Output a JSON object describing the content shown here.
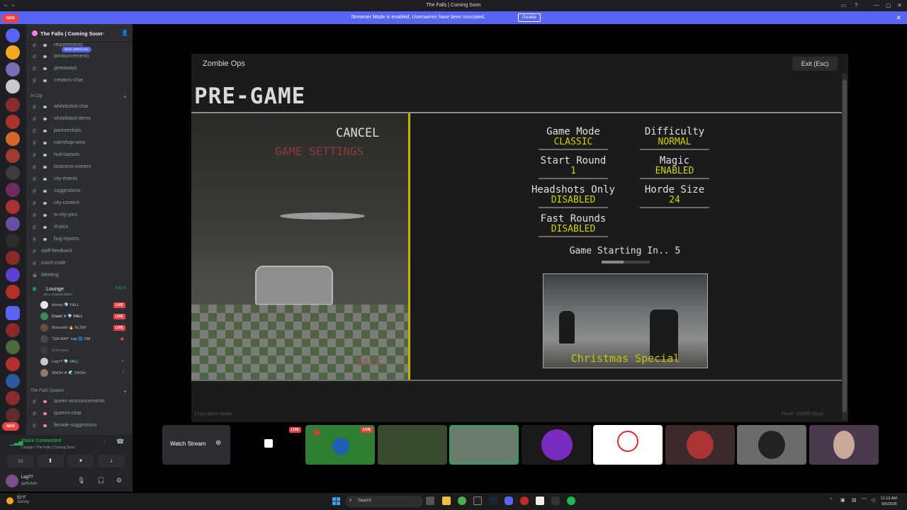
{
  "window": {
    "title": "The Falls | Coming Soon",
    "controls": [
      "▭",
      "?",
      "—",
      "▢",
      "✕"
    ]
  },
  "banner": {
    "message": "Streamer Mode is enabled. Usernames have been truncated.",
    "disable_label": "Disable"
  },
  "rail": {
    "new_badge": "NEW",
    "bottom_badge": "NEW"
  },
  "server": {
    "name": "The Falls | Coming Soon",
    "new_unreads": "NEW UNREADS"
  },
  "channels": {
    "top": [
      {
        "label": "requirements"
      },
      {
        "label": "announcements"
      },
      {
        "label": "giveaways"
      },
      {
        "label": "creators-chat"
      }
    ],
    "in_city_category": "In City",
    "in_city": [
      {
        "label": "whitelisted-chat"
      },
      {
        "label": "whitelisted-items"
      },
      {
        "label": "partnerships"
      },
      {
        "label": "coinshop-wins"
      },
      {
        "label": "hud-layouts"
      },
      {
        "label": "business-owners"
      },
      {
        "label": "city-events"
      },
      {
        "label": "suggestions"
      },
      {
        "label": "city-content"
      },
      {
        "label": "in-city-pics"
      },
      {
        "label": "irl-pics"
      },
      {
        "label": "bug-reports"
      }
    ],
    "plain": [
      {
        "label": "staff-feedback"
      },
      {
        "label": "crash-code"
      },
      {
        "label": "Meeting"
      }
    ],
    "voice": {
      "name": "Lounge",
      "status": "Set a channel status",
      "time": "9:43:31",
      "users": [
        {
          "name": "bloxey 💎 FALL",
          "live": "LIVE"
        },
        {
          "name": "Crash ✳ 💎 FALL",
          "live": "LIVE"
        },
        {
          "name": "Maiovskii 🔥 RLSM",
          "live": "LIVE"
        },
        {
          "name": "\"GM RAY\" zap 🌐 GM",
          "live": ""
        },
        {
          "name": "Cmunyun",
          "live": ""
        },
        {
          "name": "Leg?? 💎 FALL",
          "live": ""
        },
        {
          "name": "SNOH ❄ 🌊 SNOH",
          "live": ""
        }
      ]
    },
    "queens_category": "The Falls Queens",
    "queens": [
      {
        "label": "queen-announcements"
      },
      {
        "label": "queens-chat"
      },
      {
        "label": "female-suggestions"
      }
    ]
  },
  "voice_panel": {
    "title": "Voice Connected",
    "subtitle": "Lounge / The Falls | Coming Soon"
  },
  "user_panel": {
    "name": "Leg??",
    "status": "gg/thefalls"
  },
  "game": {
    "window_title": "Zombie Ops",
    "exit_label": "Exit (Esc)",
    "heading": "PRE-GAME",
    "cancel": "CANCEL",
    "game_settings": "GAME SETTINGS",
    "back": "BACK",
    "settings": [
      {
        "key": "Game Mode",
        "value": "CLASSIC"
      },
      {
        "key": "Difficulty",
        "value": "NORMAL"
      },
      {
        "key": "Start Round",
        "value": "1"
      },
      {
        "key": "Magic",
        "value": "ENABLED"
      },
      {
        "key": "Headshots Only",
        "value": "DISABLED"
      },
      {
        "key": "Horde Size",
        "value": "24"
      },
      {
        "key": "Fast Rounds",
        "value": "DISABLED"
      }
    ],
    "starting": "Game Starting In.. 5",
    "progress": 0.45,
    "preview_caption": "Christmas Special",
    "footer_left": "2 mod packs loaded",
    "footer_right": "FiveM* (b3258) (Beta)"
  },
  "streams": {
    "watch_label": "Watch Stream",
    "live": "LIVE"
  },
  "taskbar": {
    "weather_temp": "92°F",
    "weather_desc": "Sunny",
    "search": "Search",
    "time": "11:13 AM",
    "date": "8/5/2026"
  }
}
